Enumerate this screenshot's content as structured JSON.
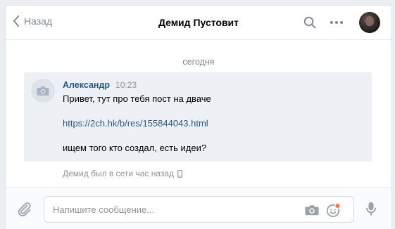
{
  "header": {
    "back_label": "Назад",
    "title": "Демид Пустовит"
  },
  "chat": {
    "date_separator": "сегодня",
    "messages": [
      {
        "author": "Александр",
        "time": "10:23",
        "line1": "Привет, тут про тебя пост на дваче",
        "link": "https://2ch.hk/b/res/155844043.html",
        "line3": "ищем того кто создал, есть идеи?"
      }
    ],
    "status": "Демид был в сети час назад"
  },
  "composer": {
    "placeholder": "Напишите сообщение..."
  },
  "colors": {
    "accent": "#2a5885",
    "icon": "#828a99",
    "message_bg": "#edf0f5",
    "notification_dot": "#ff7034"
  }
}
